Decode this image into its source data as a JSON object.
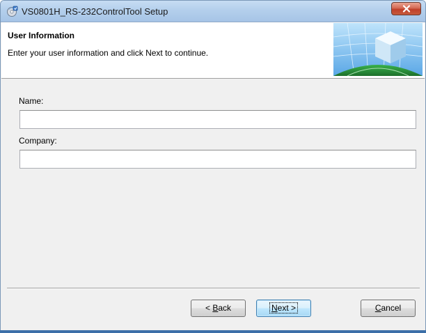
{
  "window": {
    "title": "VS0801H_RS-232ControlTool Setup",
    "icons": {
      "app": "installer-cd-icon",
      "close": "close-icon"
    }
  },
  "header": {
    "title": "User Information",
    "subtitle": "Enter your user information and click Next to continue.",
    "banner": "globe-cube-banner"
  },
  "form": {
    "name_label": "Name:",
    "name_value": "",
    "company_label": "Company:",
    "company_value": ""
  },
  "buttons": {
    "back": {
      "prefix": "< ",
      "accel": "B",
      "rest": "ack"
    },
    "next": {
      "accel": "N",
      "rest": "ext >"
    },
    "cancel": {
      "accel": "C",
      "rest": "ancel"
    }
  },
  "colors": {
    "titlebar": "#b4cfec",
    "dialog_bg": "#f0f0f0",
    "close_button": "#c7503a",
    "default_button_border": "#3c7fb1"
  }
}
